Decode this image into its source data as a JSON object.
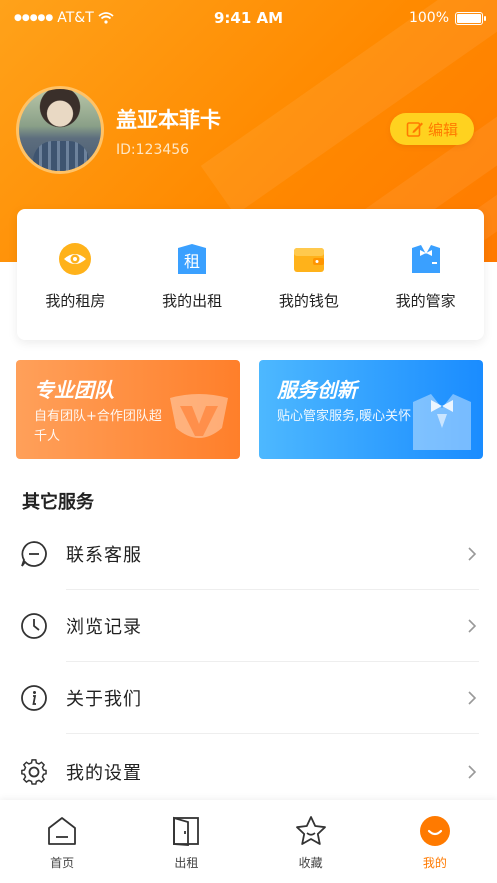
{
  "status_bar": {
    "carrier": "AT&T",
    "time": "9:41 AM",
    "battery": "100%"
  },
  "profile": {
    "name": "盖亚本菲卡",
    "id_text": "ID:123456",
    "edit_label": "编辑"
  },
  "quick_actions": [
    {
      "label": "我的租房",
      "icon": "eye-icon"
    },
    {
      "label": "我的出租",
      "icon": "rent-icon"
    },
    {
      "label": "我的钱包",
      "icon": "wallet-icon"
    },
    {
      "label": "我的管家",
      "icon": "butler-icon"
    }
  ],
  "promos": [
    {
      "title": "专业团队",
      "desc": "自有团队+合作团队超千人",
      "color": "#ff8a3d"
    },
    {
      "title": "服务创新",
      "desc": "贴心管家服务,暖心关怀",
      "color": "#2b96ff"
    }
  ],
  "other_services": {
    "title": "其它服务",
    "items": [
      {
        "label": "联系客服",
        "icon": "chat-icon"
      },
      {
        "label": "浏览记录",
        "icon": "clock-icon"
      },
      {
        "label": "关于我们",
        "icon": "info-icon"
      },
      {
        "label": "我的设置",
        "icon": "gear-icon"
      }
    ]
  },
  "tabbar": {
    "tabs": [
      {
        "label": "首页",
        "icon": "home-icon"
      },
      {
        "label": "出租",
        "icon": "door-icon"
      },
      {
        "label": "收藏",
        "icon": "star-icon"
      },
      {
        "label": "我的",
        "icon": "smile-icon",
        "active": true
      }
    ]
  },
  "colors": {
    "brand": "#ff8a00",
    "accent_yellow": "#ffd21f",
    "blue": "#2b96ff"
  }
}
